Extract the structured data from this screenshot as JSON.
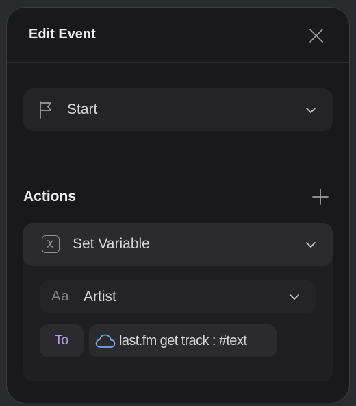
{
  "dialog": {
    "title": "Edit Event",
    "close_icon": "close-icon"
  },
  "trigger": {
    "icon": "flag-icon",
    "value": "Start"
  },
  "actions": {
    "title": "Actions",
    "add_icon": "plus-icon",
    "items": [
      {
        "icon": "variable-icon",
        "type": "Set Variable",
        "variable": {
          "icon": "text-type-icon",
          "icon_text": "Aa",
          "value": "Artist"
        },
        "to_label": "To",
        "value": {
          "icon": "cloud-icon",
          "text": "last.fm get track : #text"
        }
      }
    ]
  },
  "colors": {
    "panel_bg": "#19191b",
    "row_bg": "#242428",
    "accent_purple": "#b89be6",
    "cloud_blue": "#7aa6e8"
  }
}
